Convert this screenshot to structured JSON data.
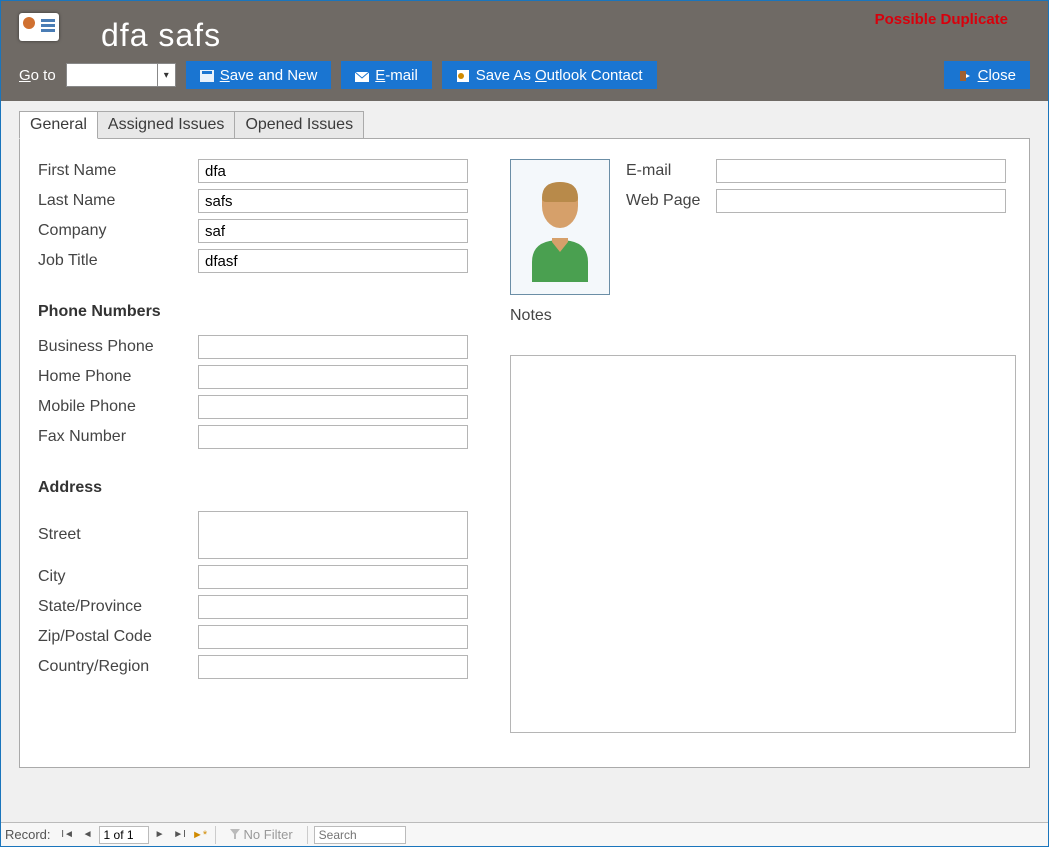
{
  "header": {
    "title": "dfa safs",
    "duplicate_warning": "Possible Duplicate",
    "goto_label_pre": "G",
    "goto_label_post": "o to",
    "save_and_new_pre": "",
    "save_and_new_ul": "S",
    "save_and_new_post": "ave and New",
    "email_ul": "E",
    "email_post": "-mail",
    "outlook_pre": "Save As ",
    "outlook_ul": "O",
    "outlook_post": "utlook Contact",
    "close_ul": "C",
    "close_post": "lose"
  },
  "tabs": {
    "general": "General",
    "assigned": "Assigned Issues",
    "opened": "Opened Issues"
  },
  "labels": {
    "first_name": "First Name",
    "last_name": "Last Name",
    "company": "Company",
    "job_title": "Job Title",
    "phone_section": "Phone Numbers",
    "business_phone": "Business Phone",
    "home_phone": "Home Phone",
    "mobile_phone": "Mobile Phone",
    "fax_number": "Fax Number",
    "address_section": "Address",
    "street": "Street",
    "city": "City",
    "state": "State/Province",
    "zip": "Zip/Postal Code",
    "country": "Country/Region",
    "email": "E-mail",
    "web_page": "Web Page",
    "notes": "Notes"
  },
  "values": {
    "first_name": "dfa",
    "last_name": "safs",
    "company": "saf",
    "job_title": "dfasf",
    "business_phone": "",
    "home_phone": "",
    "mobile_phone": "",
    "fax_number": "",
    "street": "",
    "city": "",
    "state": "",
    "zip": "",
    "country": "",
    "email": "",
    "web_page": "",
    "notes": ""
  },
  "record_nav": {
    "label": "Record:",
    "position": "1 of 1",
    "no_filter": "No Filter",
    "search_placeholder": "Search"
  }
}
